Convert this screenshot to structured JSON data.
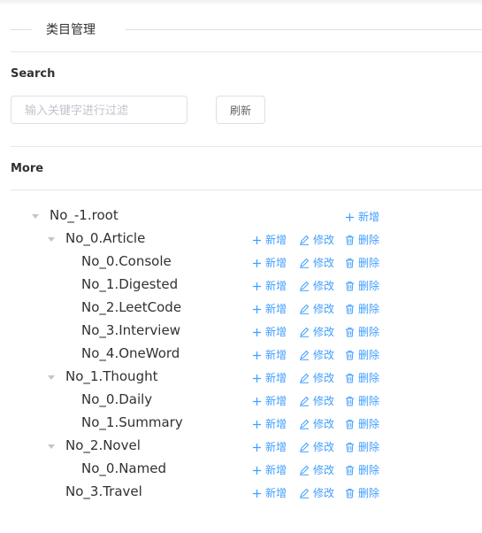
{
  "header": {
    "title": "类目管理"
  },
  "search": {
    "label": "Search",
    "placeholder": "输入关键字进行过滤",
    "refresh_label": "刷新"
  },
  "more": {
    "label": "More"
  },
  "actions": {
    "add": "新增",
    "edit": "修改",
    "delete": "删除"
  },
  "tree": [
    {
      "label": "No_-1.root",
      "level": 0,
      "expandable": true,
      "actions": [
        "add"
      ]
    },
    {
      "label": "No_0.Article",
      "level": 1,
      "expandable": true,
      "actions": [
        "add",
        "edit",
        "delete"
      ]
    },
    {
      "label": "No_0.Console",
      "level": 2,
      "expandable": false,
      "actions": [
        "add",
        "edit",
        "delete"
      ]
    },
    {
      "label": "No_1.Digested",
      "level": 2,
      "expandable": false,
      "actions": [
        "add",
        "edit",
        "delete"
      ]
    },
    {
      "label": "No_2.LeetCode",
      "level": 2,
      "expandable": false,
      "actions": [
        "add",
        "edit",
        "delete"
      ]
    },
    {
      "label": "No_3.Interview",
      "level": 2,
      "expandable": false,
      "actions": [
        "add",
        "edit",
        "delete"
      ]
    },
    {
      "label": "No_4.OneWord",
      "level": 2,
      "expandable": false,
      "actions": [
        "add",
        "edit",
        "delete"
      ]
    },
    {
      "label": "No_1.Thought",
      "level": 1,
      "expandable": true,
      "actions": [
        "add",
        "edit",
        "delete"
      ]
    },
    {
      "label": "No_0.Daily",
      "level": 2,
      "expandable": false,
      "actions": [
        "add",
        "edit",
        "delete"
      ]
    },
    {
      "label": "No_1.Summary",
      "level": 2,
      "expandable": false,
      "actions": [
        "add",
        "edit",
        "delete"
      ]
    },
    {
      "label": "No_2.Novel",
      "level": 1,
      "expandable": true,
      "actions": [
        "add",
        "edit",
        "delete"
      ]
    },
    {
      "label": "No_0.Named",
      "level": 2,
      "expandable": false,
      "actions": [
        "add",
        "edit",
        "delete"
      ]
    },
    {
      "label": "No_3.Travel",
      "level": 1,
      "expandable": false,
      "actions": [
        "add",
        "edit",
        "delete"
      ]
    }
  ],
  "colors": {
    "link": "#409eff",
    "border": "#dcdfe6",
    "text": "#303133",
    "caret": "#c0c4cc"
  }
}
